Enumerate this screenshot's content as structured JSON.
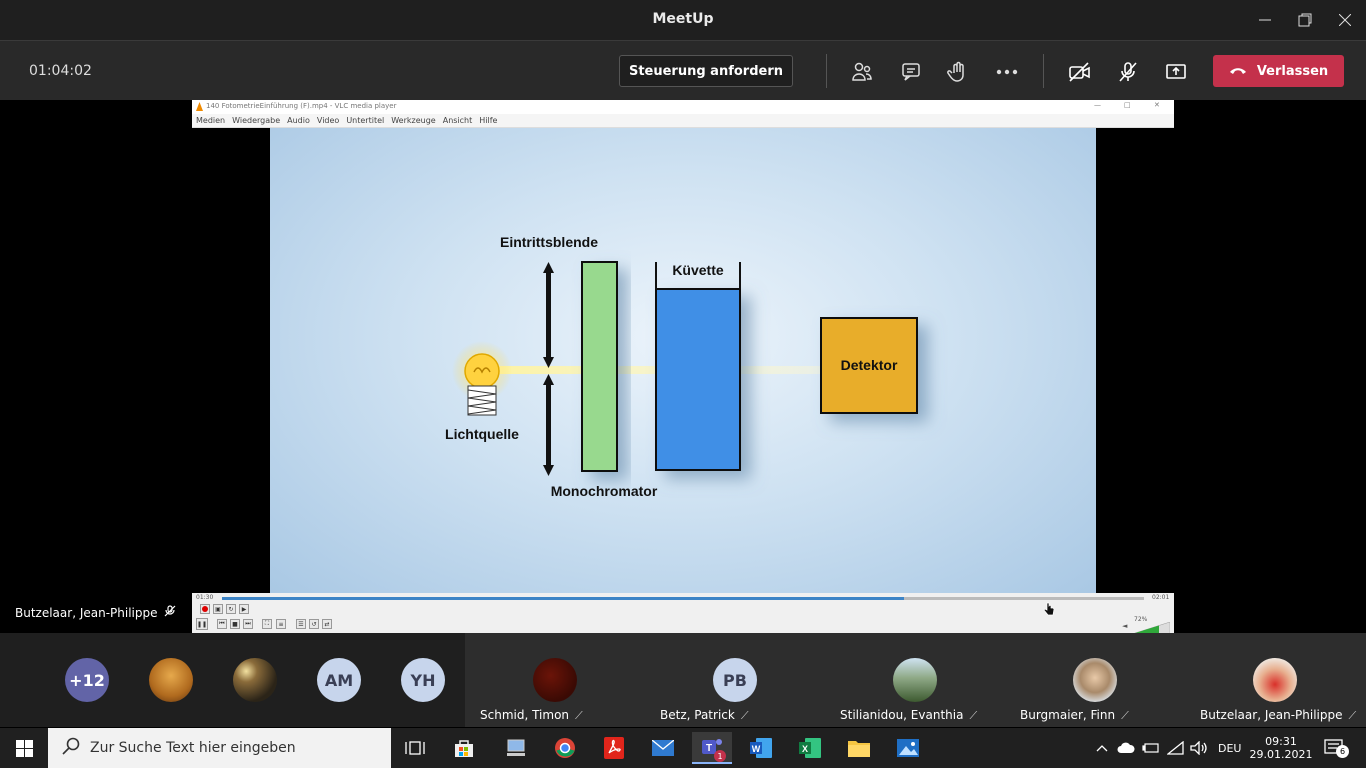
{
  "window": {
    "title": "MeetUp"
  },
  "toolbar": {
    "timer": "01:04:02",
    "request_control_label": "Steuerung anfordern",
    "leave_label": "Verlassen"
  },
  "vlc": {
    "title": "140 FotometrieEinführung (F).mp4 - VLC media player",
    "menu": [
      "Medien",
      "Wiedergabe",
      "Audio",
      "Video",
      "Untertitel",
      "Werkzeuge",
      "Ansicht",
      "Hilfe"
    ],
    "time_elapsed": "01:30",
    "time_total": "02:01",
    "progress": 0.74,
    "volume_label": "72%"
  },
  "diagram": {
    "label_entrance_slit": "Eintrittsblende",
    "label_cuvette": "Küvette",
    "label_detector": "Detektor",
    "label_light_source": "Lichtquelle",
    "label_monochromator": "Monochromator"
  },
  "presenter": {
    "name": "Butzelaar, Jean-Philippe"
  },
  "participants": {
    "overflow_count": "+12",
    "avatars": [
      "AM",
      "YH"
    ],
    "tiles": [
      {
        "name": "Schmid, Timon"
      },
      {
        "name": "Betz, Patrick",
        "initials": "PB"
      },
      {
        "name": "Stilianidou, Evanthia"
      },
      {
        "name": "Burgmaier, Finn"
      },
      {
        "name": "Butzelaar, Jean-Philippe"
      }
    ]
  },
  "taskbar": {
    "search_placeholder": "Zur Suche Text hier eingeben",
    "language": "DEU",
    "time": "09:31",
    "date": "29.01.2021",
    "notification_count": "6",
    "teams_badge": "1"
  },
  "colors": {
    "leave_red": "#c4314b",
    "avatar_purple": "#6264a7",
    "avatar_initials_bg": "#c7d5ec",
    "filter_green": "#98d98e",
    "cuvette_blue": "#3f8fe6",
    "detector_orange": "#e8ad2a"
  }
}
